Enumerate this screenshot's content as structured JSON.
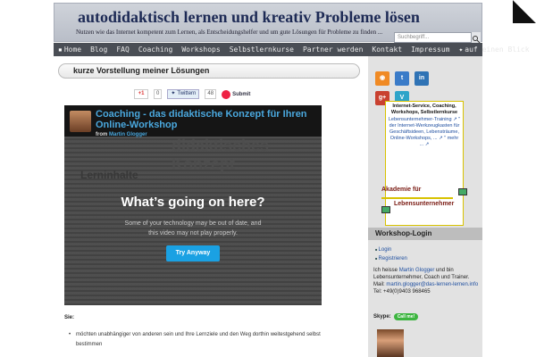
{
  "header": {
    "title": "autodidaktisch lernen und kreativ Probleme lösen",
    "description": "Nutzen wie das Internet kompetent zum Lernen, als Entscheidungshelfer und um gute Lösungen für Probleme zu finden ...",
    "search_placeholder": "Suchbegriff..."
  },
  "nav": {
    "items": [
      "Home",
      "Blog",
      "FAQ",
      "Coaching",
      "Workshops",
      "Selbstlernkurse",
      "Partner werden",
      "Kontakt",
      "Impressum",
      "auf einen Blick"
    ]
  },
  "post": {
    "title": "kurze Vorstellung meiner Lösungen",
    "share": {
      "gplus_label": "+1",
      "gplus_count": "0",
      "twitter_label": "Twittern",
      "twitter_count": "48",
      "submit_label": "Submit"
    },
    "video": {
      "title": "Coaching - das didaktische Konzept für Ihren Online-Workshop",
      "from_prefix": "from",
      "author": "Martin Glogger",
      "bg_word_1": "didaktisches Konzept",
      "bg_word_2": "Lerninhalte",
      "overlay_heading": "What’s going on here?",
      "overlay_text": "Some of your technology may be out of date, and this video may not play properly.",
      "button": "Try Anyway"
    },
    "sie_label": "Sie:",
    "bullet": "möchten unabhängiger von anderen sein und Ihre Lernziele und den Weg dorthin weitestgehend selbst bestimmen"
  },
  "sidebar": {
    "box_title": "Internet-Service, Coaching, Workshops, Selbstlernkurse",
    "box_links": "Lebensunternehmer-Training ↗ \" der Internet-Werkzeugkasten für Geschäftsideen, Lebensträume, Online-Workshops, ... ↗ \" mehr ... ↗",
    "akademie_line1": "Akademie für",
    "akademie_line2": "Lebensunternehmer",
    "workshop_login_heading": "Workshop-Login",
    "login": "Login",
    "register": "Registrieren",
    "about": {
      "prefix": "Ich heisse",
      "name": "Martin Glogger",
      "rest": "und bin Lebensunternehmer, Coach und Trainer.",
      "mail_label": "Mail:",
      "mail": "martin.glogger@das-lernen-lernen.info",
      "tel": "Tel: +49(0)9403 968465"
    },
    "skype_label": "Skype:",
    "skype_button": "Call me!"
  },
  "colors": {
    "nav_bg": "#4a4e55",
    "link": "#1f4fa0",
    "video_title": "#4aa8de",
    "try_button": "#1aa1e3"
  }
}
